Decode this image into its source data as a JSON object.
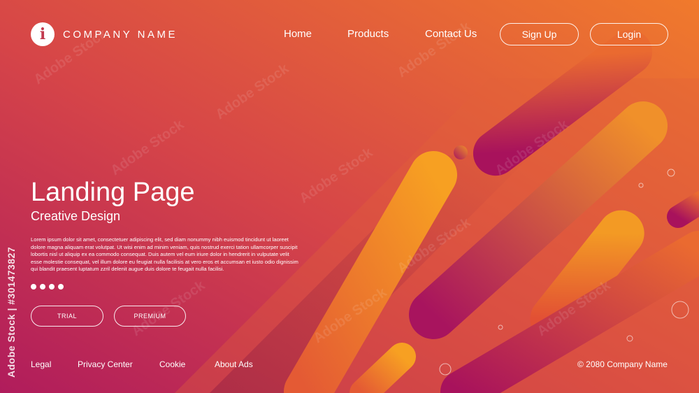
{
  "brand": {
    "name": "COMPANY NAME",
    "logo_glyph": "i"
  },
  "nav": {
    "items": [
      "Home",
      "Products",
      "Contact Us"
    ],
    "signup_label": "Sign Up",
    "login_label": "Login"
  },
  "hero": {
    "title": "Landing Page",
    "subtitle": "Creative Design",
    "body": "Lorem ipsum dolor sit amet, consectetuer adipiscing elit, sed diam nonummy nibh euismod tincidunt ut laoreet dolore magna aliquam erat volutpat. Ut wisi enim ad minim veniam, quis nostrud exerci tation ullamcorper suscipit lobortis nisl ut aliquip ex ea commodo consequat. Duis autem vel eum iriure dolor in hendrerit in vulputate velit esse molestie consequat, vel illum dolore eu feugiat nulla facilisis at vero eros et accumsan et iusto odio dignissim qui blandit praesent luptatum zzril delenit augue duis dolore te feugait nulla facilisi.",
    "trial_label": "TRIAL",
    "premium_label": "PREMIUM",
    "carousel_dots": 4
  },
  "footer": {
    "links": [
      "Legal",
      "Privacy Center",
      "Cookie",
      "About Ads"
    ],
    "copyright": "© 2080 Company Name"
  },
  "watermark": {
    "side_text": "Adobe Stock | #301473827",
    "text": "Adobe Stock"
  },
  "colors": {
    "magenta": "#b3195a",
    "pink": "#c8325a",
    "orange": "#f0752d",
    "amber": "#f59a24"
  }
}
